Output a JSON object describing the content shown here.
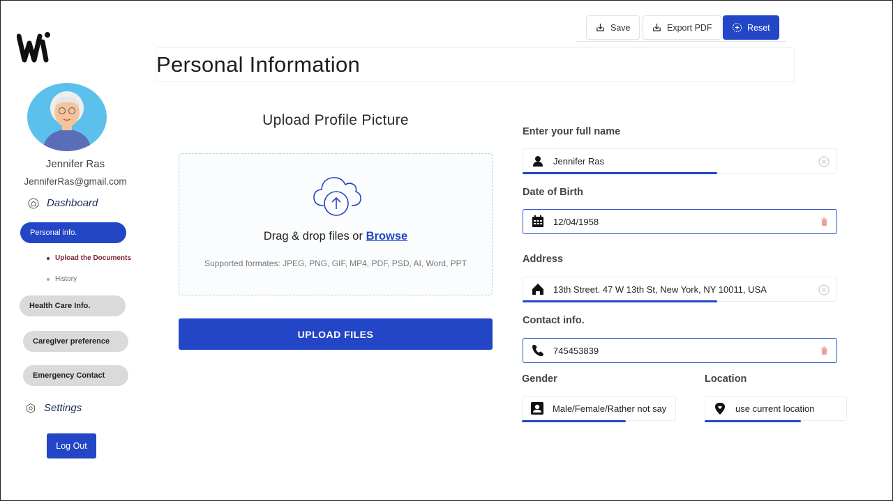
{
  "toolbar": {
    "save_label": "Save",
    "export_label": "Export PDF",
    "reset_label": "Reset"
  },
  "page": {
    "title": "Personal Information"
  },
  "profile": {
    "name": "Jennifer Ras",
    "email": "JenniferRas@gmail.com"
  },
  "sidebar": {
    "dashboard_label": "Dashboard",
    "personal_info_label": "Personal info.",
    "sub_items": [
      "Upload the Documents",
      "History"
    ],
    "health_care_label": "Health Care Info.",
    "caregiver_label": "Caregiver preference",
    "emergency_label": "Emergency Contact",
    "settings_label": "Settings",
    "logout_label": "Log Out"
  },
  "upload": {
    "title": "Upload Profile Picture",
    "drag_text": "Drag & drop files or ",
    "browse_label": "Browse",
    "formats_text": "Supported formates: JPEG, PNG, GIF, MP4, PDF, PSD, AI, Word, PPT",
    "button_label": "UPLOAD FILES"
  },
  "form": {
    "name_label": "Enter your full name",
    "name_value": "Jennifer Ras",
    "dob_label": "Date of Birth",
    "dob_value": "12/04/1958",
    "address_label": "Address",
    "address_value": "13th Street. 47 W 13th St, New York, NY 10011, USA",
    "contact_label": "Contact info.",
    "contact_value": "745453839",
    "gender_label": "Gender",
    "gender_value": "Male/Female/Rather not say",
    "location_label": "Location",
    "location_value": "use current location"
  },
  "colors": {
    "primary": "#2346c6",
    "pill_gray": "#dadada",
    "active_sub": "#7a1f2f",
    "delete_red": "#e8a0a0"
  },
  "icons": {
    "save": "download-tray-icon",
    "export": "download-tray-icon",
    "reset": "plus-circle-icon",
    "dashboard": "home-icon",
    "settings": "gear-icon",
    "upload": "cloud-upload-icon",
    "name": "person-icon",
    "dob": "calendar-icon",
    "address": "house-icon",
    "contact": "phone-icon",
    "gender": "id-badge-icon",
    "location": "location-pin-icon"
  }
}
